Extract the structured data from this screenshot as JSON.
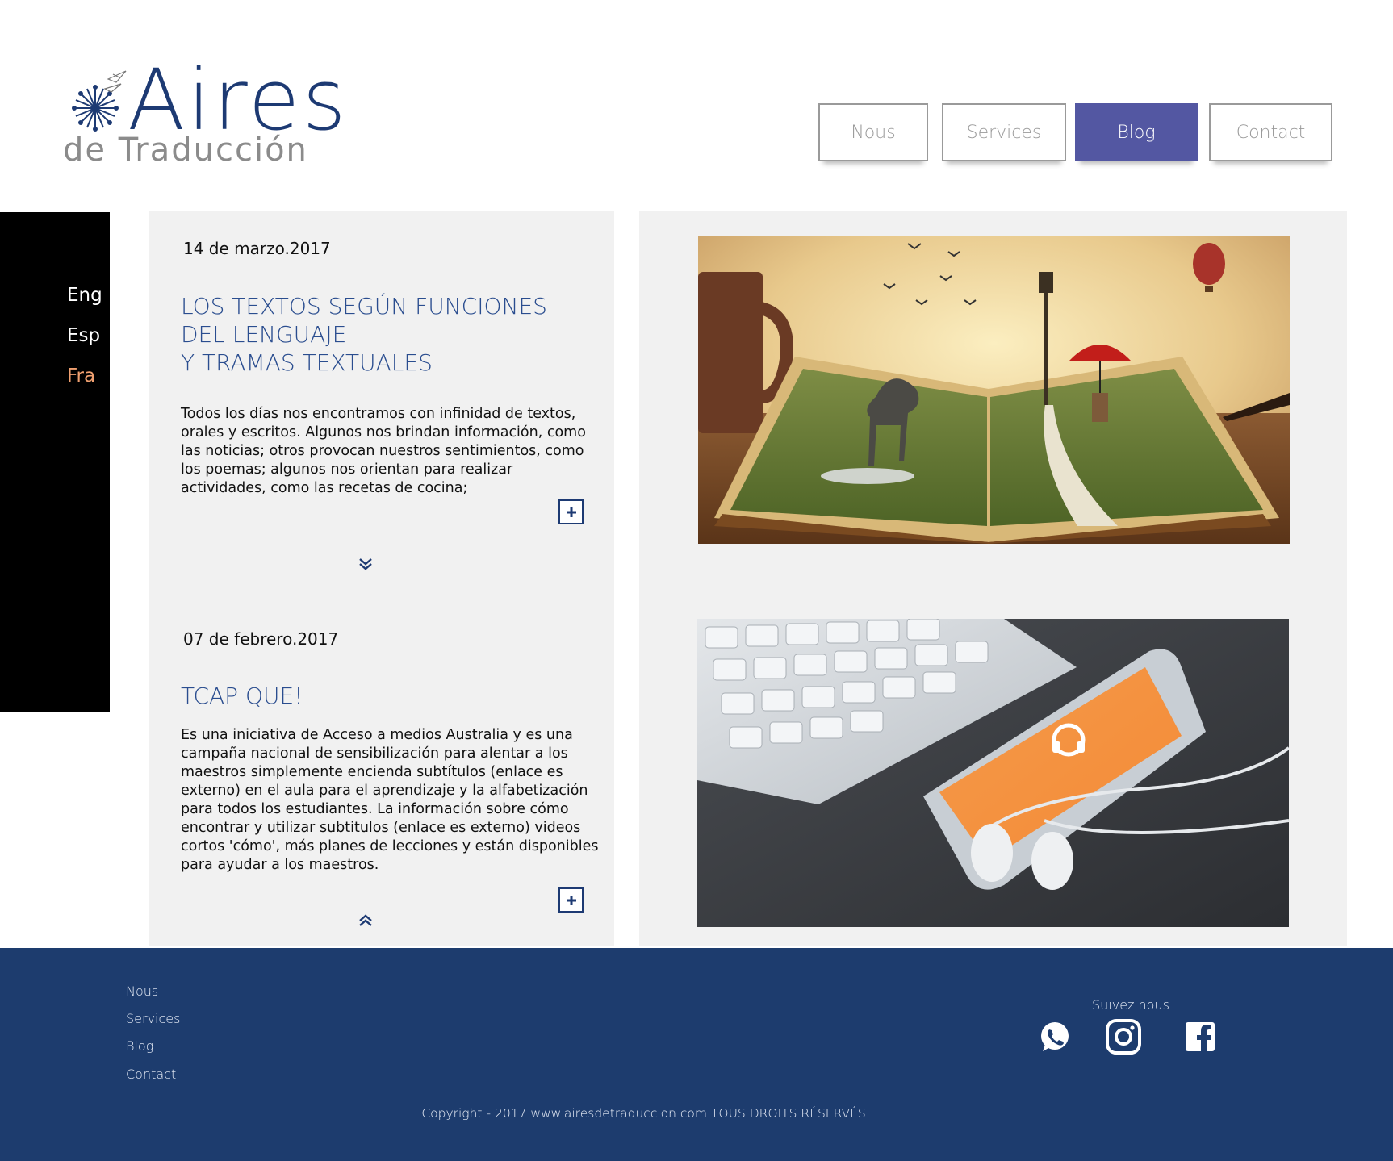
{
  "brand": {
    "name": "Aires",
    "subtitle": "de Traducción"
  },
  "nav": {
    "items": [
      {
        "label": "Nous",
        "active": false
      },
      {
        "label": "Services",
        "active": false
      },
      {
        "label": "Blog",
        "active": true
      },
      {
        "label": "Contact",
        "active": false
      }
    ]
  },
  "languages": {
    "items": [
      {
        "label": "Eng",
        "active": false
      },
      {
        "label": "Esp",
        "active": false
      },
      {
        "label": "Fra",
        "active": true
      }
    ]
  },
  "posts": [
    {
      "date": "14 de marzo.2017",
      "title_lines": [
        "LOS TEXTOS SEGÚN FUNCIONES",
        "DEL LENGUAJE",
        "Y TRAMAS TEXTUALES"
      ],
      "body": "Todos los días nos encontramos con infinidad de textos, orales y escritos. Algunos nos brindan información, como las noticias; otros provocan nuestros sentimientos, como los poemas; algunos nos orientan para realizar actividades, como las recetas de cocina;",
      "image": "open-book-dog-umbrella-girl-illustration"
    },
    {
      "date": "07 de febrero.2017",
      "title_lines": [
        "TCAP QUE!"
      ],
      "body": "Es una iniciativa de Acceso a medios Australia y es una campaña nacional de sensibilización para alentar a los maestros simplemente encienda subtítulos (enlace es externo) en el aula para el aprendizaje y la alfabetización para todos los estudiantes. La información sobre cómo encontrar y utilizar subtitulos (enlace es externo) videos cortos 'cómo', más planes de lecciones y están disponibles para ayudar a los maestros.",
      "image": "keyboard-smartphone-earphones-photo"
    }
  ],
  "footer": {
    "links": [
      "Nous",
      "Services",
      "Blog",
      "Contact"
    ],
    "follow_label": "Suivez nous",
    "social": [
      "whatsapp-icon",
      "instagram-icon",
      "facebook-icon"
    ],
    "copyright": "Copyright - 2017 www.airesdetraduccion.com TOUS DROITS RÉSERVÉS."
  },
  "colors": {
    "brand_navy": "#1d3a73",
    "accent_blue": "#5357a2",
    "footer_bg": "#1d3c6e",
    "active_lang": "#f0a070"
  }
}
